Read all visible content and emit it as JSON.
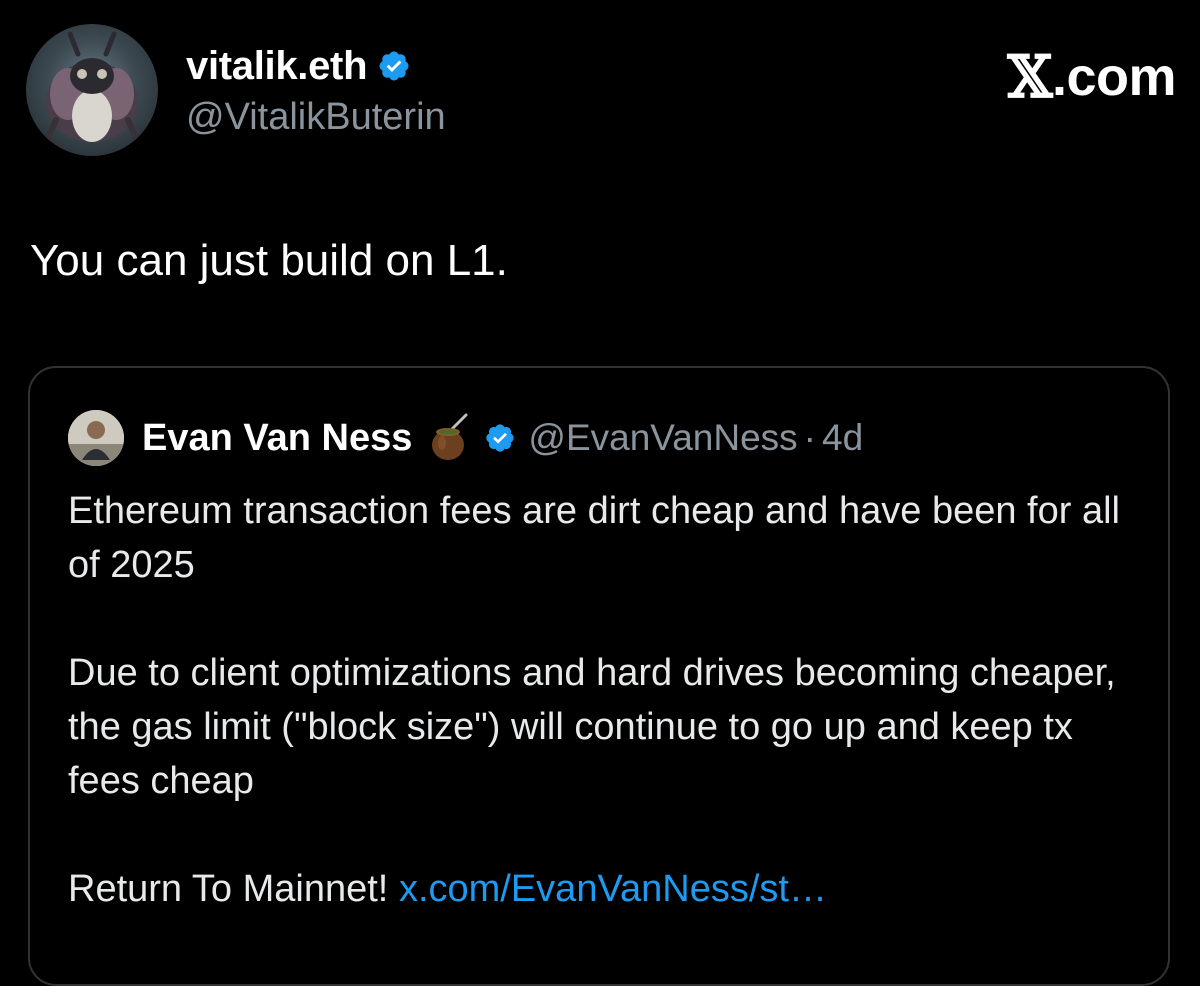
{
  "post": {
    "author": {
      "name": "vitalik.eth",
      "handle": "@VitalikButerin",
      "verified": true
    },
    "brand": {
      "x_glyph": "𝕏",
      "tld": ".com"
    },
    "text": "You can just build on L1."
  },
  "quote": {
    "author": {
      "name": "Evan Van Ness",
      "emoji": "mate-gourd-icon",
      "verified": true,
      "handle": "@EvanVanNess",
      "separator": "·",
      "time": "4d"
    },
    "paragraphs": [
      "Ethereum transaction fees are dirt cheap and have been for all of 2025",
      "Due to client optimizations and hard drives becoming cheaper, the gas limit (\"block size\") will continue to go up and keep tx fees cheap"
    ],
    "final_line": {
      "text": "Return To Mainnet! ",
      "link": "x.com/EvanVanNess/st…"
    }
  },
  "colors": {
    "background": "#000000",
    "primary_text": "#ffffff",
    "secondary_text": "#8b949c",
    "verified_blue": "#1d9bf0",
    "link_blue": "#1d9bf0",
    "card_border": "#2f3336"
  }
}
